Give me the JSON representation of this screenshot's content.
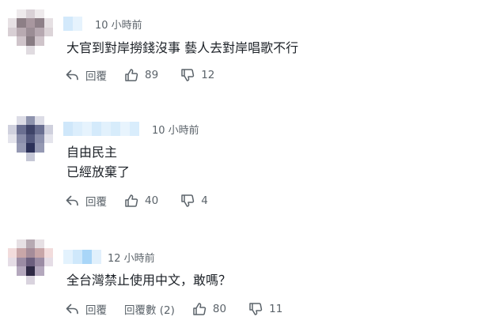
{
  "comments": [
    {
      "time": "10 小時前",
      "text_lines": [
        "大官到對岸撈錢沒事 藝人去對岸唱歌不行"
      ],
      "reply_label": "回覆",
      "replies_label": "",
      "likes": "89",
      "dislikes": "12"
    },
    {
      "time": "10 小時前",
      "text_lines": [
        "自由民主",
        "已經放棄了"
      ],
      "reply_label": "回覆",
      "replies_label": "",
      "likes": "40",
      "dislikes": "4"
    },
    {
      "time": "12 小時前",
      "text_lines": [
        "全台灣禁止使用中文，敢嗎？"
      ],
      "reply_label": "回覆",
      "replies_label": "回覆數 (2)",
      "likes": "80",
      "dislikes": "11"
    }
  ],
  "icons": {
    "reply": "reply-arrow-icon",
    "like": "thumbs-up-icon",
    "dislike": "thumbs-down-icon"
  },
  "colors": {
    "text": "#1d2228",
    "meta": "#5b636a",
    "name_blur": "#d6ecfb"
  }
}
